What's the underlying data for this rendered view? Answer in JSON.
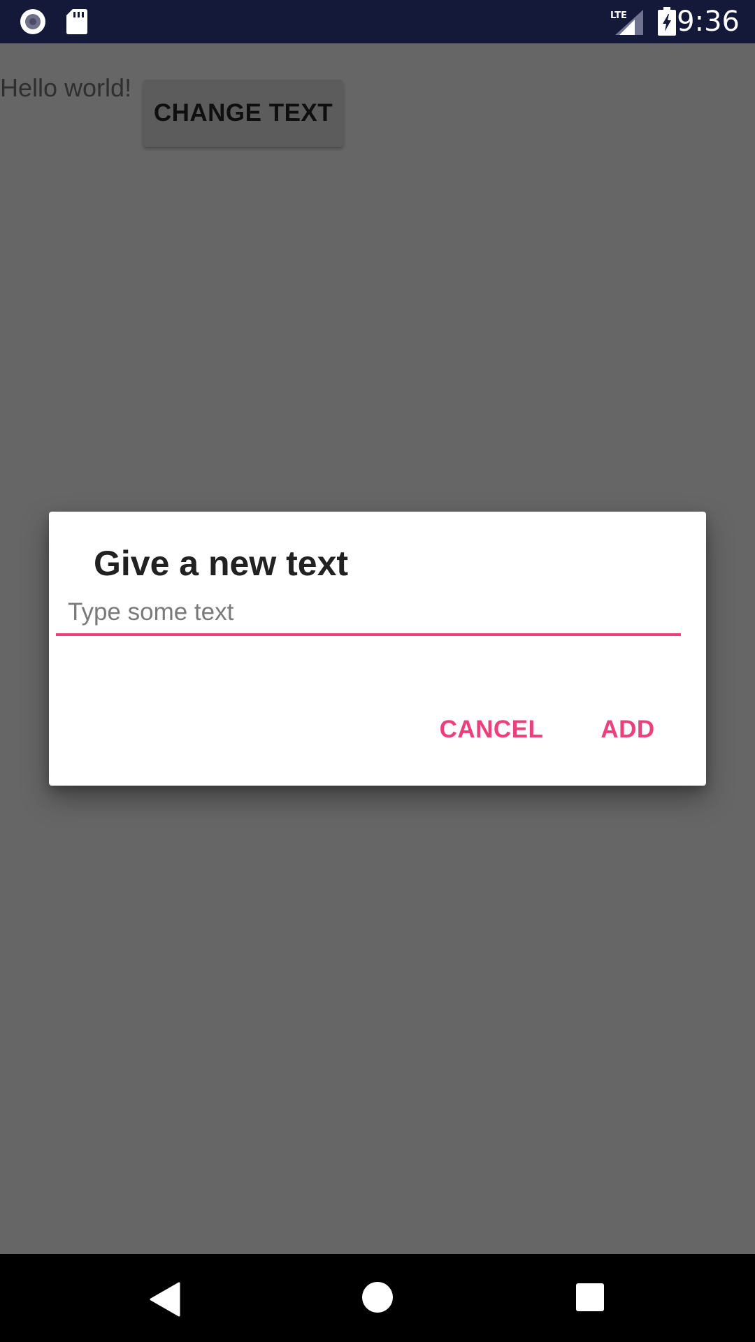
{
  "status_bar": {
    "time": "9:36",
    "icons": [
      "record-icon",
      "sd-card-icon",
      "lte-signal-icon",
      "battery-charging-icon"
    ],
    "network_label": "LTE"
  },
  "main": {
    "hello_text": "Hello world!",
    "change_text_button_label": "CHANGE TEXT"
  },
  "dialog": {
    "title": "Give a new text",
    "input_value": "",
    "input_placeholder": "Type some text",
    "cancel_label": "CANCEL",
    "add_label": "ADD"
  },
  "nav_bar": {
    "icons": [
      "back-icon",
      "home-icon",
      "recents-icon"
    ]
  },
  "colors": {
    "status_bar_bg": "#141839",
    "scrim_bg": "#666666",
    "accent": "#ec407a",
    "dialog_bg": "#ffffff",
    "nav_bar_bg": "#000000"
  }
}
